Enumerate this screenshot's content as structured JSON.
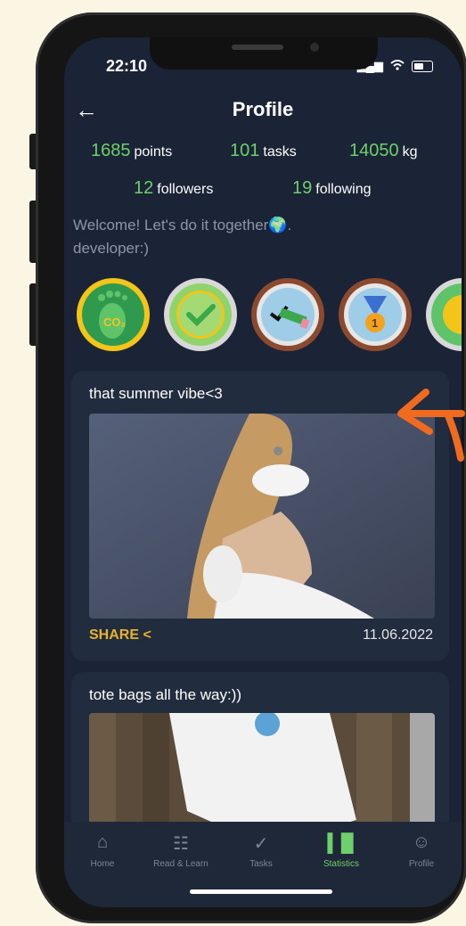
{
  "status": {
    "time": "22:10"
  },
  "header": {
    "title": "Profile"
  },
  "stats": [
    {
      "value": "1685",
      "label": "points"
    },
    {
      "value": "101",
      "label": "tasks"
    },
    {
      "value": "14050",
      "label": "kg"
    }
  ],
  "social": [
    {
      "value": "12",
      "label": "followers"
    },
    {
      "value": "19",
      "label": "following"
    }
  ],
  "bio": {
    "line1": "Welcome! Let's do it together🌍.",
    "line2": "developer:)"
  },
  "badges": [
    {
      "name": "co2-footprint-badge",
      "icon": "footprint-icon",
      "text": "CO₂"
    },
    {
      "name": "checkmark-badge",
      "icon": "check-icon"
    },
    {
      "name": "pencil-badge",
      "icon": "pencil-icon"
    },
    {
      "name": "medal-badge",
      "icon": "medal-icon",
      "text": "1"
    },
    {
      "name": "partial-badge",
      "icon": "leaf-icon"
    }
  ],
  "posts": [
    {
      "caption": "that summer vibe<3",
      "share": "SHARE",
      "date": "11.06.2022"
    },
    {
      "caption": "tote bags all the way:))"
    }
  ],
  "tabs": [
    {
      "label": "Home",
      "icon": "home-icon",
      "active": false
    },
    {
      "label": "Read & Learn",
      "icon": "document-icon",
      "active": false
    },
    {
      "label": "Tasks",
      "icon": "check-circle-icon",
      "active": false
    },
    {
      "label": "Statistics",
      "icon": "bar-chart-icon",
      "active": true
    },
    {
      "label": "Profile",
      "icon": "person-icon",
      "active": false
    }
  ],
  "colors": {
    "accent": "#6dd06b",
    "share": "#e8b32a",
    "background": "#1b2436",
    "annotation_arrow": "#f06a1f"
  }
}
